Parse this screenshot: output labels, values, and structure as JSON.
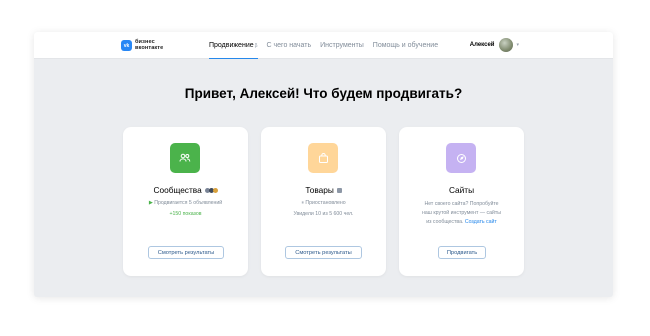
{
  "header": {
    "logo_mark": "vk",
    "logo_line1": "бизнес",
    "logo_line2": "вконтакте",
    "nav": [
      {
        "label": "Продвижение",
        "badge": "β"
      },
      {
        "label": "С чего начать"
      },
      {
        "label": "Инструменты"
      },
      {
        "label": "Помощь и обучение"
      }
    ],
    "user_name": "Алексей"
  },
  "heading": "Привет, Алексей! Что будем продвигать?",
  "cards": {
    "communities": {
      "icon": "people-icon",
      "color": "#4bb34b",
      "title": "Сообщества",
      "status": "Продвигается 5 объявлений",
      "extra": "+150 показов",
      "button": "Смотреть результаты"
    },
    "goods": {
      "icon": "bag-icon",
      "color": "#ffd699",
      "title": "Товары",
      "status": "Приостановлено",
      "extra": "Увидели 10 из 5 600 чел.",
      "button": "Смотреть результаты"
    },
    "sites": {
      "icon": "compass-icon",
      "color": "#c5b2f2",
      "title": "Сайты",
      "desc_line1": "Нет своего сайта? Попробуйте",
      "desc_line2": "наш крутой инструмент — сайты",
      "desc_line3": "из сообщества.",
      "desc_link": "Создать сайт",
      "button": "Продвигать"
    }
  }
}
